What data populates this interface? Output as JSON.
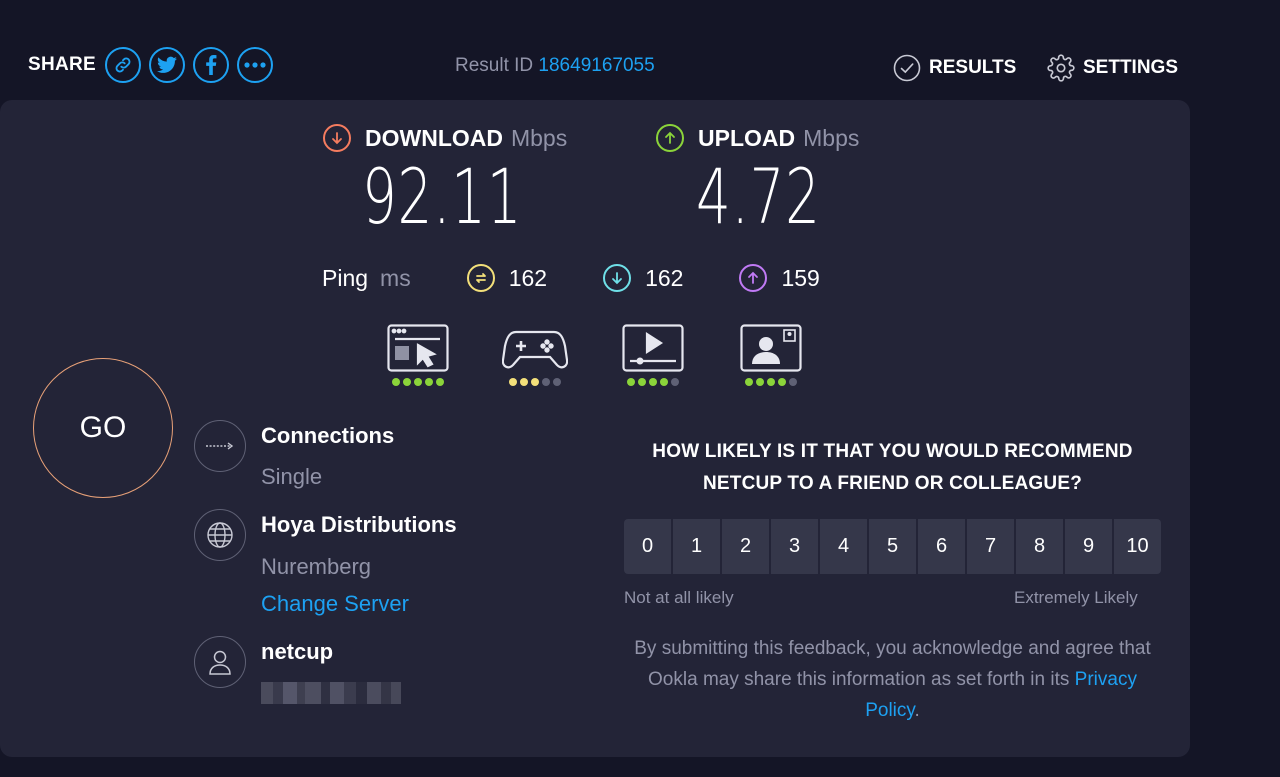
{
  "header": {
    "share_label": "SHARE",
    "share_buttons": [
      "link-icon",
      "twitter-icon",
      "facebook-icon",
      "more-icon"
    ],
    "result_id_label": "Result ID",
    "result_id": "18649167055",
    "results_label": "RESULTS",
    "settings_label": "SETTINGS"
  },
  "download": {
    "label": "DOWNLOAD",
    "unit": "Mbps",
    "value": "92.11",
    "color": "#f57c5f"
  },
  "upload": {
    "label": "UPLOAD",
    "unit": "Mbps",
    "value": "4.72",
    "color": "#8bd43a"
  },
  "ping": {
    "label": "Ping",
    "unit": "ms",
    "idle": {
      "value": "162",
      "color": "#f3e07a"
    },
    "download": {
      "value": "162",
      "color": "#6fe0e8"
    },
    "upload": {
      "value": "159",
      "color": "#c07af5"
    }
  },
  "use_cases": [
    {
      "icon": "browsing-icon",
      "rating": 5
    },
    {
      "icon": "gaming-icon",
      "rating": 3
    },
    {
      "icon": "streaming-icon",
      "rating": 4
    },
    {
      "icon": "video-call-icon",
      "rating": 4
    }
  ],
  "go_label": "GO",
  "connections": {
    "title": "Connections",
    "value": "Single"
  },
  "server": {
    "title": "Hoya Distributions",
    "location": "Nuremberg",
    "change_label": "Change Server"
  },
  "isp": {
    "title": "netcup"
  },
  "survey": {
    "question": "HOW LIKELY IS IT THAT YOU WOULD RECOMMEND NETCUP TO A FRIEND OR COLLEAGUE?",
    "scale": [
      "0",
      "1",
      "2",
      "3",
      "4",
      "5",
      "6",
      "7",
      "8",
      "9",
      "10"
    ],
    "low_label": "Not at all likely",
    "high_label": "Extremely Likely",
    "disclaimer": "By submitting this feedback, you acknowledge and agree that Ookla may share this information as set forth in its",
    "privacy_label": "Privacy Policy",
    "period": "."
  },
  "colors": {
    "accent_blue": "#1da1f2",
    "dot_good": "#8bd43a",
    "dot_mid": "#f3e07a",
    "dot_off": "#5f6175"
  }
}
